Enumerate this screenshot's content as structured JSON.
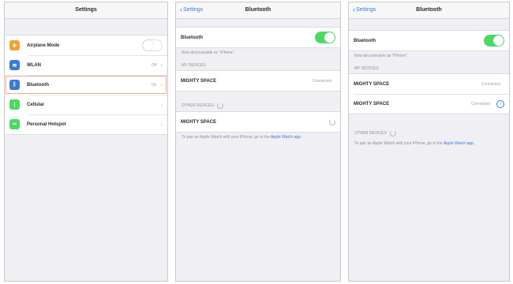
{
  "screen1": {
    "title": "Settings",
    "items": [
      {
        "label": "Airplane Mode",
        "value": "",
        "icon": "airplane-icon",
        "color": "#f0a23a"
      },
      {
        "label": "WLAN",
        "value": "Off",
        "icon": "wifi-icon",
        "color": "#3a7bd5"
      },
      {
        "label": "Bluetooth",
        "value": "On",
        "icon": "bluetooth-icon",
        "color": "#3a7bd5"
      },
      {
        "label": "Cellular",
        "value": "",
        "icon": "cellular-icon",
        "color": "#4cd964"
      },
      {
        "label": "Personal Hotspot",
        "value": "",
        "icon": "hotspot-icon",
        "color": "#4cd964"
      }
    ]
  },
  "screen2": {
    "back_label": "Settings",
    "title": "Bluetooth",
    "bluetooth_label": "Bluetooth",
    "discoverable_note": "Now discoverable as \"iPhone\".",
    "my_devices_header": "MY DEVICES",
    "my_devices": [
      {
        "name": "MIGHTY SPACE",
        "status": "Connected"
      }
    ],
    "other_devices_header": "OTHER DEVICES",
    "other_devices": [
      {
        "name": "MIGHTY SPACE"
      }
    ],
    "pair_note": "To pair an Apple Watch with your iPhone, go to the",
    "pair_link": "Apple Watch app."
  },
  "screen3": {
    "back_label": "Settings",
    "title": "Bluetooth",
    "bluetooth_label": "Bluetooth",
    "discoverable_note": "Now discoverable as \"iPhone\".",
    "my_devices_header": "MY DEVICES",
    "my_devices": [
      {
        "name": "MIGHTY SPACE",
        "status": "Connected"
      },
      {
        "name": "MIGHTY SPACE",
        "status": "Connected"
      }
    ],
    "other_devices_header": "OTHER DEVICES",
    "pair_note": "To pair an Apple Watch with your iPhone, go to the",
    "pair_link": "Apple Watch app."
  },
  "colors": {
    "accent": "#3a7bd5",
    "toggle_on": "#4cd964",
    "highlight": "#f0a58d"
  }
}
